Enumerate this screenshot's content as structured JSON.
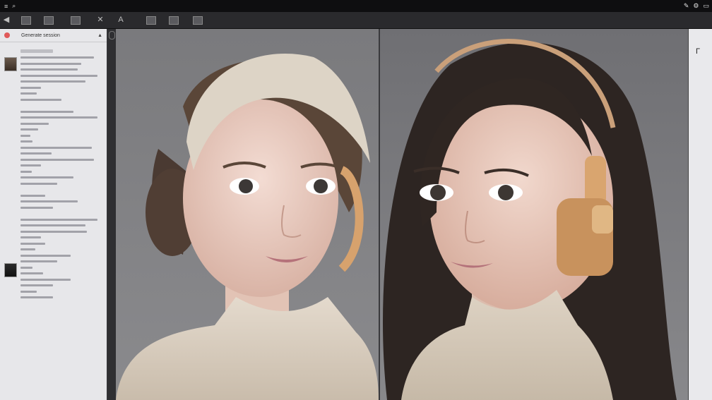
{
  "topbar": {
    "glyphs": [
      "✎",
      "⚙",
      "▭"
    ],
    "app_menu": [
      "≡",
      "⌕"
    ]
  },
  "toolbar": {
    "tools": [
      "◀",
      "✕",
      "✎",
      "A"
    ]
  },
  "left_panel": {
    "header_title": "Generate session",
    "collapse_glyph": "▲"
  },
  "right_panel": {
    "glyph": "Γ"
  },
  "colors": {
    "accent": "#e05a5a",
    "canvas_bg": "#7d7d80",
    "panel_bg": "#e7e7ea"
  }
}
